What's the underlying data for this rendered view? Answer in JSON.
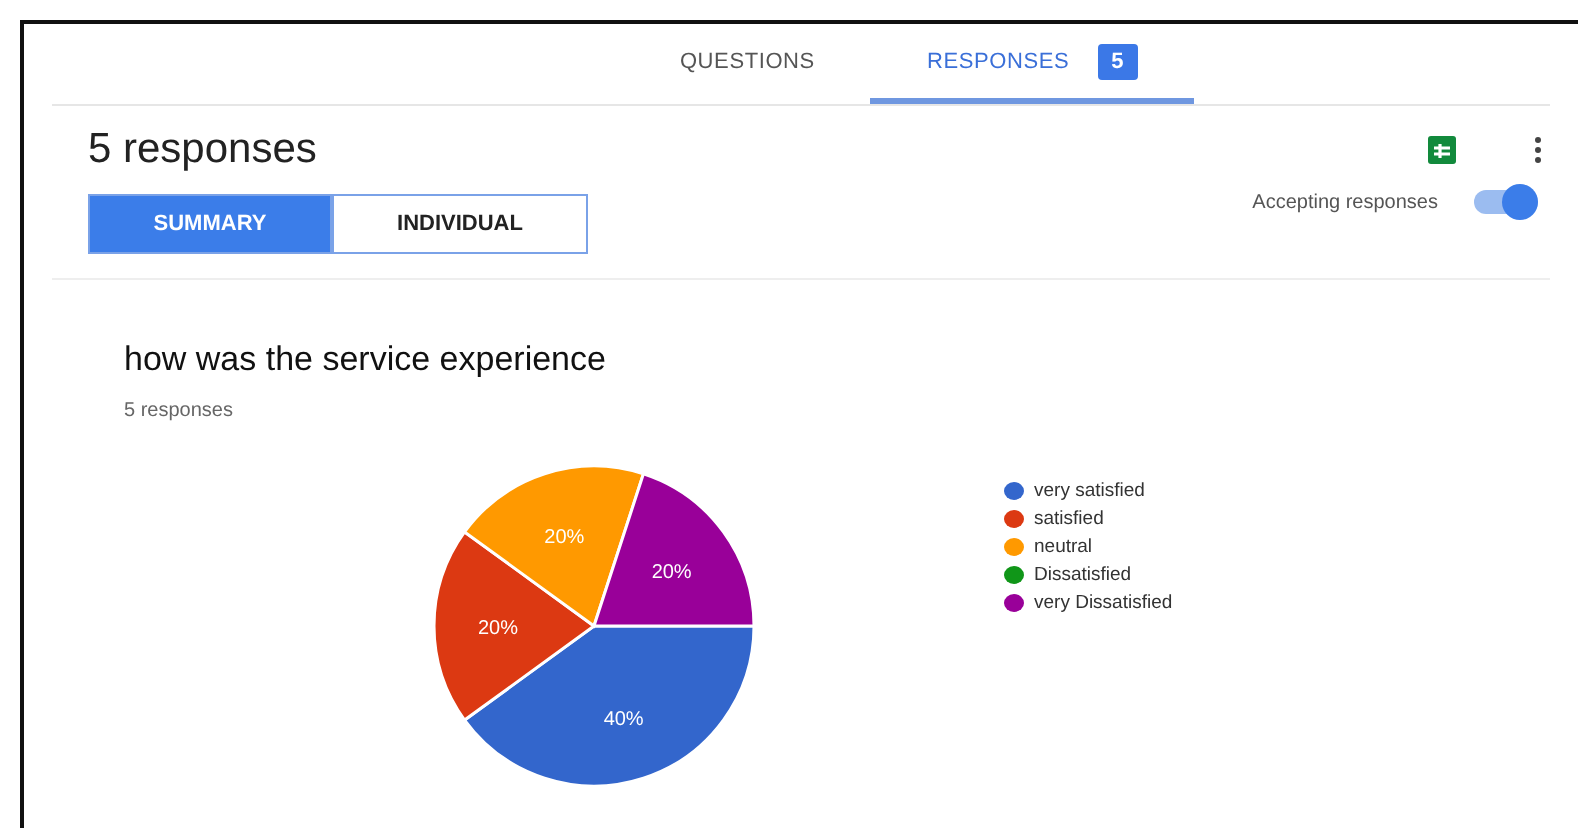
{
  "tabs": [
    {
      "label": "QUESTIONS",
      "selected": false
    },
    {
      "label": "RESPONSES",
      "selected": true,
      "badge": "5"
    }
  ],
  "header": {
    "title": "5 responses"
  },
  "view_toggle": [
    {
      "label": "SUMMARY",
      "selected": true
    },
    {
      "label": "INDIVIDUAL",
      "selected": false
    }
  ],
  "accepting": {
    "label": "Accepting responses",
    "on": true
  },
  "question": {
    "title": "how was the service experience",
    "count": "5 responses",
    "chart_data": {
      "type": "pie",
      "categories": [
        "very satisfied",
        "satisfied",
        "neutral",
        "Dissatisfied",
        "very Dissatisfied"
      ],
      "legend": "right",
      "series": [
        {
          "colors": [
            "#3366cc",
            "#dc3912",
            "#ff9900",
            "#109618",
            "#990099"
          ],
          "values": [
            40,
            20,
            20,
            0,
            20
          ]
        }
      ],
      "value_labels": [
        "40%",
        "20%",
        "20%",
        null,
        "20%"
      ]
    }
  }
}
